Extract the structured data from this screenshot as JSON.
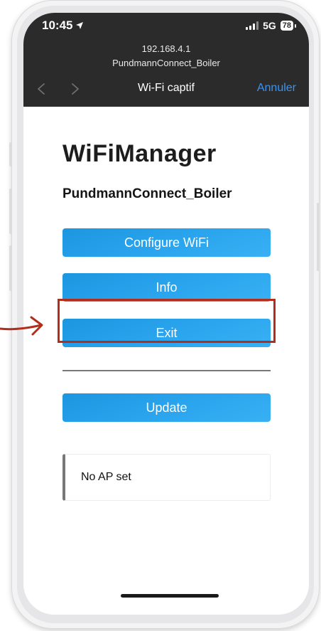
{
  "status_bar": {
    "time": "10:45",
    "network": "5G",
    "battery": "78"
  },
  "browser": {
    "url_host": "192.168.4.1",
    "page_title": "PundmannConnect_Boiler",
    "nav_title": "Wi-Fi captif",
    "cancel_label": "Annuler"
  },
  "app": {
    "title": "WiFiManager",
    "device_name": "PundmannConnect_Boiler",
    "buttons": {
      "configure": "Configure WiFi",
      "info": "Info",
      "exit": "Exit",
      "update": "Update"
    },
    "status_message": "No AP set"
  },
  "colors": {
    "button_blue": "#2aa5ee",
    "header_dark": "#2b2b2b",
    "link_blue": "#3a93f1",
    "annotation_red": "#b12e1c"
  },
  "icons": [
    "location-arrow-icon",
    "signal-bars-icon",
    "battery-icon",
    "back-chevron-icon",
    "forward-chevron-icon",
    "annotation-arrow-icon"
  ]
}
